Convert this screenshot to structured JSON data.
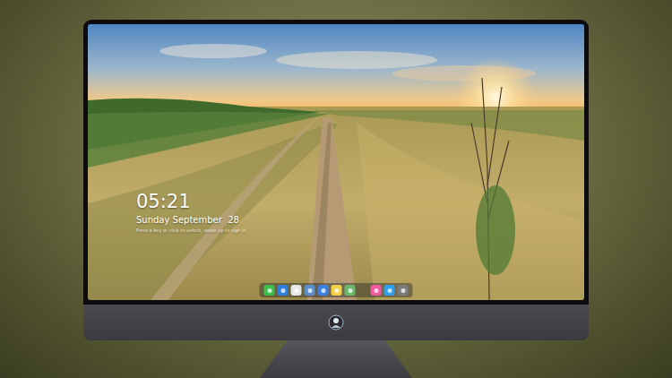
{
  "lock_screen": {
    "time": "05:21",
    "date": "Sunday September  28",
    "message": "Press a key or click to unlock, swipe up to sign in"
  },
  "dock": {
    "items": [
      {
        "color": "#3dbd4a"
      },
      {
        "color": "#2f7fd8"
      },
      {
        "color": "#e6e6e6"
      },
      {
        "color": "#5a8fc8"
      },
      {
        "color": "#3b7fe0"
      },
      {
        "color": "#f3d04a"
      },
      {
        "color": "#6bb86b"
      },
      {
        "color": "#f05aa0"
      },
      {
        "color": "#2c9ff0"
      },
      {
        "color": "#7b7b80"
      }
    ]
  }
}
